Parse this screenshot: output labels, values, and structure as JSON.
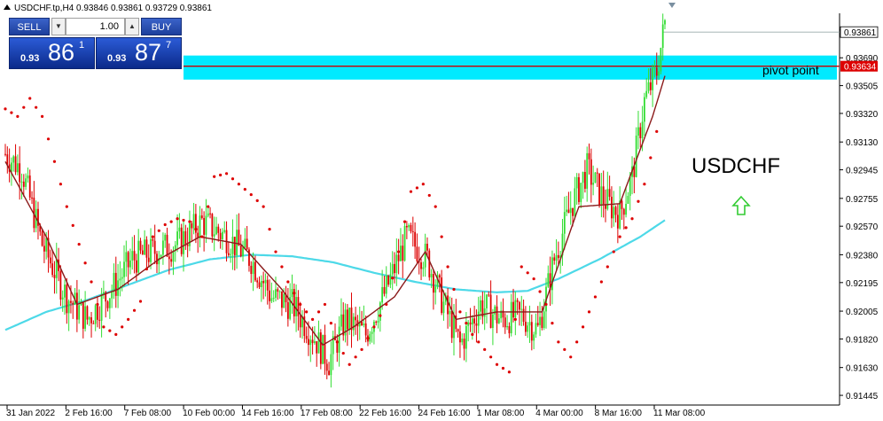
{
  "header": {
    "symbol_line": "USDCHF.tp,H4  0.93846 0.93861 0.93729 0.93861"
  },
  "trade_panel": {
    "sell_label": "SELL",
    "buy_label": "BUY",
    "volume": "1.00",
    "sell_price": {
      "prefix": "0.93",
      "big": "86",
      "sup": "1"
    },
    "buy_price": {
      "prefix": "0.93",
      "big": "87",
      "sup": "7"
    }
  },
  "annotations": {
    "pivot_label": "pivot point",
    "symbol_label": "USDCHF",
    "arrow_color": "#33cc33"
  },
  "price_tags": {
    "current": "0.93861",
    "pivot": "0.93634"
  },
  "colors": {
    "bull_candle": "#33dd33",
    "bear_candle": "#dd0000",
    "sar_dots": "#dd0000",
    "fast_ma": "#8b1a1a",
    "slow_ma": "#4dd9e8",
    "zone": "#00eaff",
    "pivot_line": "#cc0000"
  },
  "chart_data": {
    "type": "candlestick",
    "symbol": "USDCHF.tp",
    "timeframe": "H4",
    "ohlc_last": {
      "open": 0.93846,
      "high": 0.93861,
      "low": 0.93729,
      "close": 0.93861
    },
    "y_ticks": [
      0.93875,
      0.9369,
      0.93505,
      0.9332,
      0.9313,
      0.92945,
      0.92755,
      0.9257,
      0.9238,
      0.92195,
      0.92005,
      0.9182,
      0.9163,
      0.91445
    ],
    "x_ticks": [
      "31 Jan 2022",
      "2 Feb 16:00",
      "7 Feb 08:00",
      "10 Feb 00:00",
      "14 Feb 16:00",
      "17 Feb 08:00",
      "22 Feb 16:00",
      "24 Feb 16:00",
      "1 Mar 08:00",
      "4 Mar 00:00",
      "8 Mar 16:00",
      "11 Mar 08:00"
    ],
    "ylim": [
      0.9141,
      0.9398
    ],
    "pivot_level": 0.93634,
    "zone": [
      0.93545,
      0.93705
    ],
    "close_path": [
      [
        0,
        0.9305
      ],
      [
        8,
        0.9295
      ],
      [
        18,
        0.9245
      ],
      [
        30,
        0.921
      ],
      [
        40,
        0.9195
      ],
      [
        52,
        0.9215
      ],
      [
        62,
        0.9235
      ],
      [
        72,
        0.924
      ],
      [
        84,
        0.9245
      ],
      [
        96,
        0.926
      ],
      [
        108,
        0.925
      ],
      [
        120,
        0.9235
      ],
      [
        130,
        0.921
      ],
      [
        140,
        0.9205
      ],
      [
        150,
        0.9185
      ],
      [
        158,
        0.9167
      ],
      [
        166,
        0.9195
      ],
      [
        176,
        0.9185
      ],
      [
        186,
        0.9215
      ],
      [
        196,
        0.925
      ],
      [
        206,
        0.9235
      ],
      [
        214,
        0.9205
      ],
      [
        222,
        0.9178
      ],
      [
        232,
        0.9205
      ],
      [
        242,
        0.9195
      ],
      [
        252,
        0.9198
      ],
      [
        260,
        0.9188
      ],
      [
        268,
        0.9235
      ],
      [
        276,
        0.927
      ],
      [
        284,
        0.9295
      ],
      [
        292,
        0.9275
      ],
      [
        300,
        0.9265
      ],
      [
        306,
        0.929
      ],
      [
        312,
        0.934
      ],
      [
        318,
        0.936
      ],
      [
        322,
        0.9392
      ]
    ],
    "series": [
      {
        "name": "Fast MA",
        "values": [
          [
            0,
            0.93
          ],
          [
            20,
            0.925
          ],
          [
            35,
            0.9205
          ],
          [
            55,
            0.9215
          ],
          [
            75,
            0.9235
          ],
          [
            95,
            0.925
          ],
          [
            115,
            0.9245
          ],
          [
            135,
            0.9215
          ],
          [
            155,
            0.9178
          ],
          [
            170,
            0.919
          ],
          [
            190,
            0.921
          ],
          [
            205,
            0.924
          ],
          [
            220,
            0.9195
          ],
          [
            240,
            0.92
          ],
          [
            262,
            0.92
          ],
          [
            280,
            0.927
          ],
          [
            300,
            0.9272
          ],
          [
            316,
            0.933
          ],
          [
            322,
            0.9357
          ]
        ]
      },
      {
        "name": "Slow MA",
        "values": [
          [
            0,
            0.9188
          ],
          [
            20,
            0.92
          ],
          [
            40,
            0.9208
          ],
          [
            60,
            0.9218
          ],
          [
            80,
            0.9228
          ],
          [
            100,
            0.9235
          ],
          [
            120,
            0.9238
          ],
          [
            140,
            0.9237
          ],
          [
            160,
            0.9233
          ],
          [
            180,
            0.9226
          ],
          [
            200,
            0.922
          ],
          [
            220,
            0.9215
          ],
          [
            240,
            0.9213
          ],
          [
            255,
            0.9214
          ],
          [
            270,
            0.9222
          ],
          [
            290,
            0.9235
          ],
          [
            310,
            0.925
          ],
          [
            322,
            0.9261
          ]
        ]
      },
      {
        "name": "Parabolic SAR",
        "values": [
          [
            0,
            0.9335
          ],
          [
            6,
            0.933
          ],
          [
            12,
            0.9342
          ],
          [
            18,
            0.933
          ],
          [
            24,
            0.93
          ],
          [
            30,
            0.927
          ],
          [
            36,
            0.9245
          ],
          [
            42,
            0.922
          ],
          [
            48,
            0.919
          ],
          [
            54,
            0.9185
          ],
          [
            60,
            0.9195
          ],
          [
            66,
            0.9207
          ],
          [
            72,
            0.925
          ],
          [
            78,
            0.9258
          ],
          [
            84,
            0.9262
          ],
          [
            90,
            0.926
          ],
          [
            96,
            0.925
          ],
          [
            102,
            0.929
          ],
          [
            108,
            0.9292
          ],
          [
            114,
            0.9285
          ],
          [
            120,
            0.9278
          ],
          [
            126,
            0.927
          ],
          [
            132,
            0.924
          ],
          [
            138,
            0.922
          ],
          [
            144,
            0.9205
          ],
          [
            150,
            0.9195
          ],
          [
            156,
            0.9205
          ],
          [
            162,
            0.918
          ],
          [
            168,
            0.9165
          ],
          [
            174,
            0.9175
          ],
          [
            180,
            0.919
          ],
          [
            186,
            0.9205
          ],
          [
            192,
            0.924
          ],
          [
            198,
            0.928
          ],
          [
            204,
            0.9285
          ],
          [
            210,
            0.927
          ],
          [
            216,
            0.923
          ],
          [
            222,
            0.92
          ],
          [
            228,
            0.9185
          ],
          [
            234,
            0.9175
          ],
          [
            240,
            0.9165
          ],
          [
            246,
            0.916
          ],
          [
            252,
            0.923
          ],
          [
            258,
            0.9222
          ],
          [
            264,
            0.9205
          ],
          [
            270,
            0.918
          ],
          [
            276,
            0.917
          ],
          [
            282,
            0.919
          ],
          [
            288,
            0.921
          ],
          [
            294,
            0.923
          ],
          [
            300,
            0.925
          ],
          [
            306,
            0.9262
          ],
          [
            312,
            0.9285
          ],
          [
            318,
            0.932
          ]
        ]
      }
    ]
  }
}
